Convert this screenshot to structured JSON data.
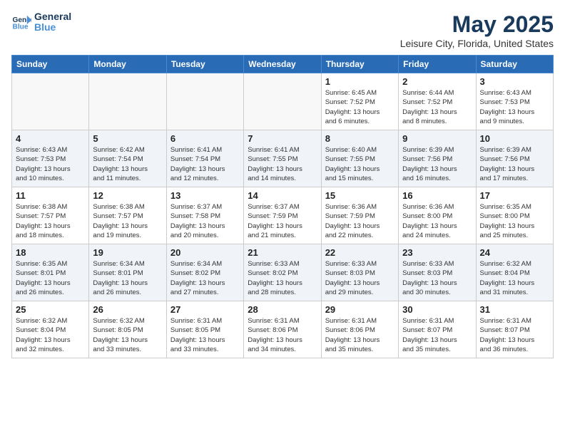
{
  "header": {
    "logo_line1": "General",
    "logo_line2": "Blue",
    "month_year": "May 2025",
    "location": "Leisure City, Florida, United States"
  },
  "weekdays": [
    "Sunday",
    "Monday",
    "Tuesday",
    "Wednesday",
    "Thursday",
    "Friday",
    "Saturday"
  ],
  "weeks": [
    [
      {
        "day": "",
        "info": ""
      },
      {
        "day": "",
        "info": ""
      },
      {
        "day": "",
        "info": ""
      },
      {
        "day": "",
        "info": ""
      },
      {
        "day": "1",
        "info": "Sunrise: 6:45 AM\nSunset: 7:52 PM\nDaylight: 13 hours\nand 6 minutes."
      },
      {
        "day": "2",
        "info": "Sunrise: 6:44 AM\nSunset: 7:52 PM\nDaylight: 13 hours\nand 8 minutes."
      },
      {
        "day": "3",
        "info": "Sunrise: 6:43 AM\nSunset: 7:53 PM\nDaylight: 13 hours\nand 9 minutes."
      }
    ],
    [
      {
        "day": "4",
        "info": "Sunrise: 6:43 AM\nSunset: 7:53 PM\nDaylight: 13 hours\nand 10 minutes."
      },
      {
        "day": "5",
        "info": "Sunrise: 6:42 AM\nSunset: 7:54 PM\nDaylight: 13 hours\nand 11 minutes."
      },
      {
        "day": "6",
        "info": "Sunrise: 6:41 AM\nSunset: 7:54 PM\nDaylight: 13 hours\nand 12 minutes."
      },
      {
        "day": "7",
        "info": "Sunrise: 6:41 AM\nSunset: 7:55 PM\nDaylight: 13 hours\nand 14 minutes."
      },
      {
        "day": "8",
        "info": "Sunrise: 6:40 AM\nSunset: 7:55 PM\nDaylight: 13 hours\nand 15 minutes."
      },
      {
        "day": "9",
        "info": "Sunrise: 6:39 AM\nSunset: 7:56 PM\nDaylight: 13 hours\nand 16 minutes."
      },
      {
        "day": "10",
        "info": "Sunrise: 6:39 AM\nSunset: 7:56 PM\nDaylight: 13 hours\nand 17 minutes."
      }
    ],
    [
      {
        "day": "11",
        "info": "Sunrise: 6:38 AM\nSunset: 7:57 PM\nDaylight: 13 hours\nand 18 minutes."
      },
      {
        "day": "12",
        "info": "Sunrise: 6:38 AM\nSunset: 7:57 PM\nDaylight: 13 hours\nand 19 minutes."
      },
      {
        "day": "13",
        "info": "Sunrise: 6:37 AM\nSunset: 7:58 PM\nDaylight: 13 hours\nand 20 minutes."
      },
      {
        "day": "14",
        "info": "Sunrise: 6:37 AM\nSunset: 7:59 PM\nDaylight: 13 hours\nand 21 minutes."
      },
      {
        "day": "15",
        "info": "Sunrise: 6:36 AM\nSunset: 7:59 PM\nDaylight: 13 hours\nand 22 minutes."
      },
      {
        "day": "16",
        "info": "Sunrise: 6:36 AM\nSunset: 8:00 PM\nDaylight: 13 hours\nand 24 minutes."
      },
      {
        "day": "17",
        "info": "Sunrise: 6:35 AM\nSunset: 8:00 PM\nDaylight: 13 hours\nand 25 minutes."
      }
    ],
    [
      {
        "day": "18",
        "info": "Sunrise: 6:35 AM\nSunset: 8:01 PM\nDaylight: 13 hours\nand 26 minutes."
      },
      {
        "day": "19",
        "info": "Sunrise: 6:34 AM\nSunset: 8:01 PM\nDaylight: 13 hours\nand 26 minutes."
      },
      {
        "day": "20",
        "info": "Sunrise: 6:34 AM\nSunset: 8:02 PM\nDaylight: 13 hours\nand 27 minutes."
      },
      {
        "day": "21",
        "info": "Sunrise: 6:33 AM\nSunset: 8:02 PM\nDaylight: 13 hours\nand 28 minutes."
      },
      {
        "day": "22",
        "info": "Sunrise: 6:33 AM\nSunset: 8:03 PM\nDaylight: 13 hours\nand 29 minutes."
      },
      {
        "day": "23",
        "info": "Sunrise: 6:33 AM\nSunset: 8:03 PM\nDaylight: 13 hours\nand 30 minutes."
      },
      {
        "day": "24",
        "info": "Sunrise: 6:32 AM\nSunset: 8:04 PM\nDaylight: 13 hours\nand 31 minutes."
      }
    ],
    [
      {
        "day": "25",
        "info": "Sunrise: 6:32 AM\nSunset: 8:04 PM\nDaylight: 13 hours\nand 32 minutes."
      },
      {
        "day": "26",
        "info": "Sunrise: 6:32 AM\nSunset: 8:05 PM\nDaylight: 13 hours\nand 33 minutes."
      },
      {
        "day": "27",
        "info": "Sunrise: 6:31 AM\nSunset: 8:05 PM\nDaylight: 13 hours\nand 33 minutes."
      },
      {
        "day": "28",
        "info": "Sunrise: 6:31 AM\nSunset: 8:06 PM\nDaylight: 13 hours\nand 34 minutes."
      },
      {
        "day": "29",
        "info": "Sunrise: 6:31 AM\nSunset: 8:06 PM\nDaylight: 13 hours\nand 35 minutes."
      },
      {
        "day": "30",
        "info": "Sunrise: 6:31 AM\nSunset: 8:07 PM\nDaylight: 13 hours\nand 35 minutes."
      },
      {
        "day": "31",
        "info": "Sunrise: 6:31 AM\nSunset: 8:07 PM\nDaylight: 13 hours\nand 36 minutes."
      }
    ]
  ]
}
